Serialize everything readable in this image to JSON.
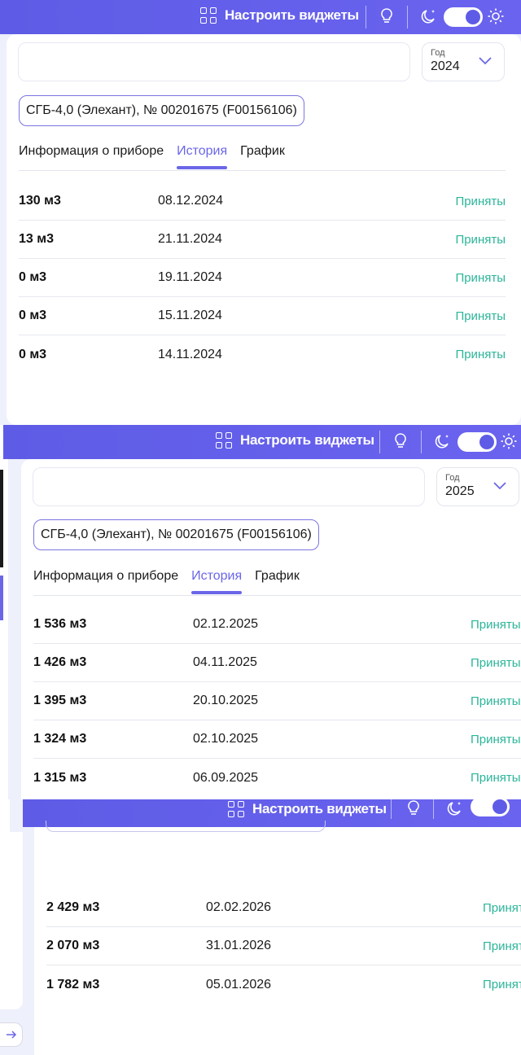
{
  "topbar": {
    "widgets_label": "Настроить виджеты",
    "icons": [
      "widgets-grid-icon",
      "lightbulb-icon",
      "moon-icon",
      "sun-icon"
    ]
  },
  "screen1": {
    "year_label": "Год",
    "year_value": "2024",
    "device": "СГБ-4,0 (Элехант), № 00201675 (F00156106)",
    "tabs": [
      "Информация о приборе",
      "История",
      "График"
    ],
    "active_tab": "История",
    "rows": [
      {
        "value": "130 м3",
        "date": "08.12.2024",
        "status": "Приняты"
      },
      {
        "value": "13 м3",
        "date": "21.11.2024",
        "status": "Приняты"
      },
      {
        "value": "0 м3",
        "date": "19.11.2024",
        "status": "Приняты"
      },
      {
        "value": "0 м3",
        "date": "15.11.2024",
        "status": "Приняты"
      },
      {
        "value": "0 м3",
        "date": "14.11.2024",
        "status": "Приняты"
      }
    ]
  },
  "screen2": {
    "year_label": "Год",
    "year_value": "2025",
    "device": "СГБ-4,0 (Элехант), № 00201675 (F00156106)",
    "tabs": [
      "Информация о приборе",
      "История",
      "График"
    ],
    "active_tab": "История",
    "rows": [
      {
        "value": "1 536 м3",
        "date": "02.12.2025",
        "status": "Приняты"
      },
      {
        "value": "1 426 м3",
        "date": "04.11.2025",
        "status": "Приняты"
      },
      {
        "value": "1 395 м3",
        "date": "20.10.2025",
        "status": "Приняты"
      },
      {
        "value": "1 324 м3",
        "date": "02.10.2025",
        "status": "Приняты"
      },
      {
        "value": "1 315 м3",
        "date": "06.09.2025",
        "status": "Приняты"
      }
    ]
  },
  "screen3": {
    "rows": [
      {
        "value": "2 429 м3",
        "date": "02.02.2026",
        "status": "Приняты"
      },
      {
        "value": "2 070 м3",
        "date": "31.01.2026",
        "status": "Приняты"
      },
      {
        "value": "1 782 м3",
        "date": "05.01.2026",
        "status": "Приняты"
      }
    ]
  },
  "colors": {
    "topbar": "#5e5ce6",
    "accent": "#6b66e8",
    "status_accepted": "#2bb59a"
  }
}
